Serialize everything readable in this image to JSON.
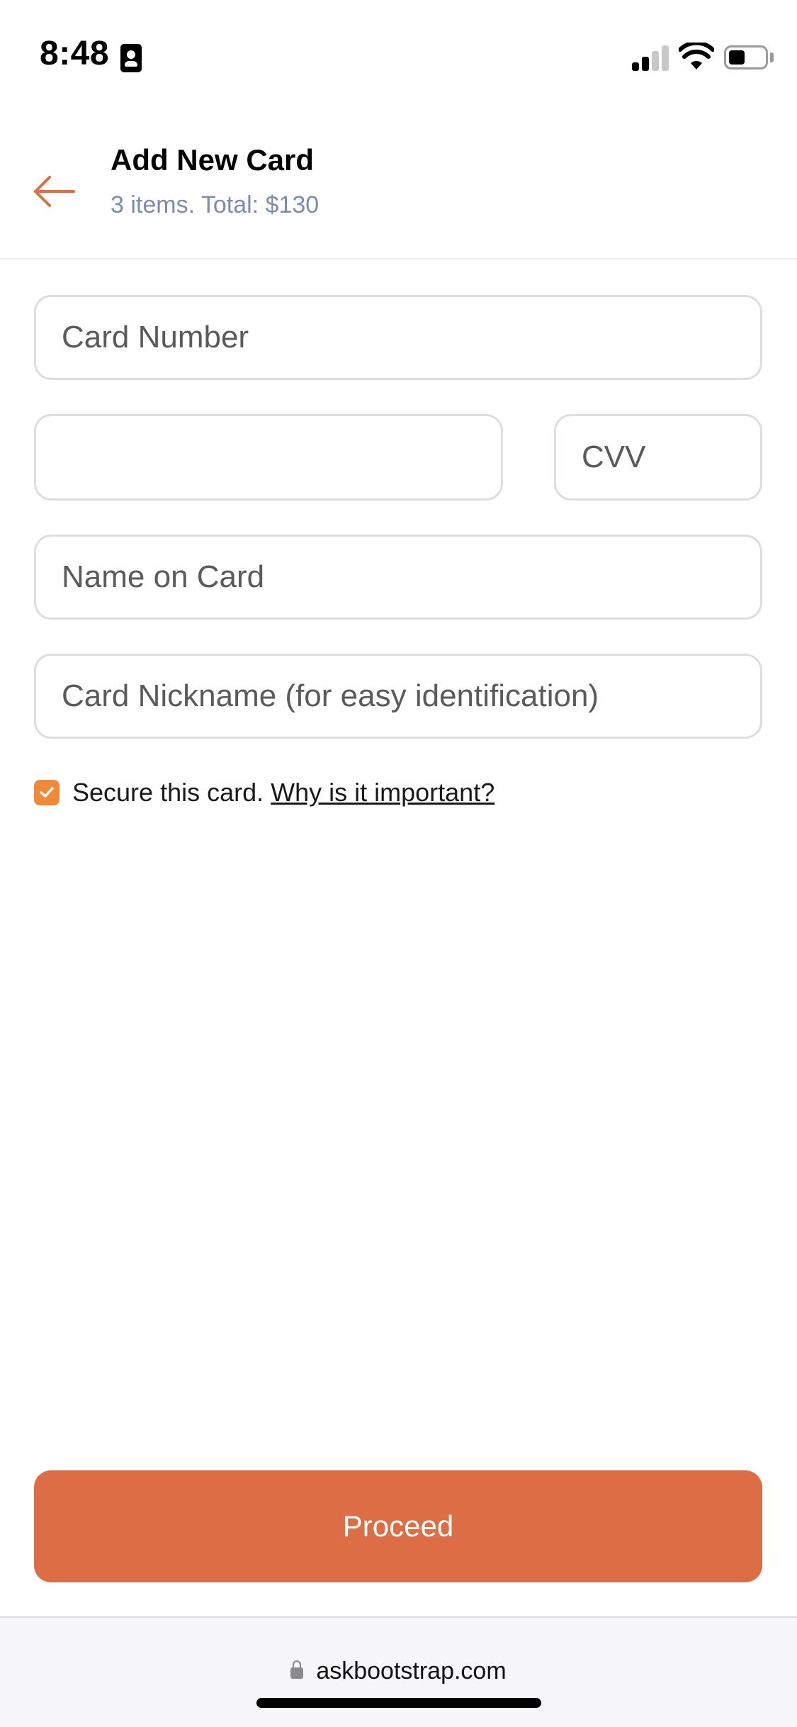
{
  "status_bar": {
    "time": "8:48"
  },
  "header": {
    "title": "Add New Card",
    "subtitle": "3 items. Total: $130",
    "back_icon": "arrow-left-icon"
  },
  "form": {
    "card_number": {
      "value": "",
      "placeholder": "Card Number"
    },
    "expiry": {
      "value": "",
      "placeholder": ""
    },
    "cvv": {
      "value": "",
      "placeholder": "CVV"
    },
    "name_on_card": {
      "value": "",
      "placeholder": "Name on Card"
    },
    "nickname": {
      "value": "",
      "placeholder": "Card Nickname (for easy identification)"
    },
    "secure": {
      "checked": true,
      "label": "Secure this card.",
      "link": "Why is it important?"
    }
  },
  "actions": {
    "proceed_label": "Proceed"
  },
  "browser": {
    "url": "askbootstrap.com"
  },
  "colors": {
    "accent": "#dd6d44",
    "checkbox": "#f08a3b",
    "subtitle": "#7b8cb3",
    "border": "#dedede"
  }
}
